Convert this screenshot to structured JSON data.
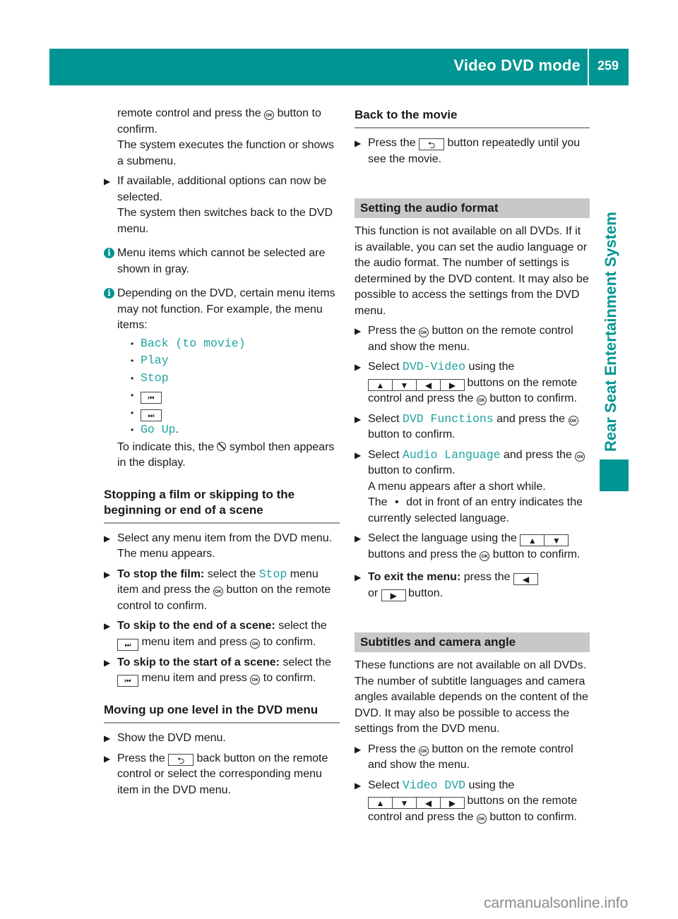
{
  "header": {
    "title": "Video DVD mode",
    "page_number": "259",
    "side_tab": "Rear Seat Entertainment System",
    "accent_color": "#009593"
  },
  "left": {
    "intro_cont_1": "remote control and press the",
    "intro_cont_2": "button to confirm.",
    "intro_cont_3": "The system executes the function or shows a submenu.",
    "step_available": "If available, additional options can now be selected.",
    "step_available_result": "The system then switches back to the DVD menu.",
    "info_gray": "Menu items which cannot be selected are shown in gray.",
    "info_depending": "Depending on the DVD, certain menu items may not function. For example, the menu items:",
    "menu_items": [
      "Back (to movie)",
      "Play",
      "Stop",
      "Go Up"
    ],
    "prev_key": "⏮",
    "next_key": "⏭",
    "go_up_suffix": ".",
    "indicate_1": "To indicate this, the",
    "indicate_2": "symbol then appears in the display.",
    "section_stop": {
      "heading": "Stopping a film or skipping to the beginning or end of a scene",
      "step1": "Select any menu item from the DVD menu.",
      "step1_result": "The menu appears.",
      "step2_bold": "To stop the film:",
      "step2_a": "select the",
      "step2_code": "Stop",
      "step2_b": "menu item and press the",
      "step2_c": "button on the remote control to confirm.",
      "step3_bold": "To skip to the end of a scene:",
      "step3_a": "select the",
      "step3_b": "menu item and press",
      "step3_c": "to confirm.",
      "step4_bold": "To skip to the start of a scene:",
      "step4_a": "select the",
      "step4_b": "menu item and press",
      "step4_c": "to confirm."
    },
    "section_up": {
      "heading": "Moving up one level in the DVD menu",
      "step1": "Show the DVD menu.",
      "step2_a": "Press the",
      "step2_b": "back button on the remote control or select the corresponding menu item in the DVD menu."
    }
  },
  "right": {
    "section_back": {
      "heading": "Back to the movie",
      "step1_a": "Press the",
      "step1_b": "button repeatedly until you see the movie."
    },
    "section_audio": {
      "heading": "Setting the audio format",
      "intro": "This function is not available on all DVDs. If it is available, you can set the audio language or the audio format. The number of settings is determined by the DVD content. It may also be possible to access the settings from the DVD menu.",
      "step1_a": "Press the",
      "step1_b": "button on the remote control and show the menu.",
      "step2_a": "Select",
      "step2_code": "DVD-Video",
      "step2_b": "using the",
      "step2_c": "buttons on the remote control and press the",
      "step2_d": "button to confirm.",
      "step3_a": "Select",
      "step3_code": "DVD Functions",
      "step3_b": "and press the",
      "step3_c": "button to confirm.",
      "step4_a": "Select",
      "step4_code": "Audio Language",
      "step4_b": "and press the",
      "step4_c": "button to confirm.",
      "step4_r1": "A menu appears after a short while.",
      "step4_r2a": "The",
      "step4_r2b": "dot in front of an entry indicates the currently selected language.",
      "step5_a": "Select the language using the",
      "step5_b": "buttons and press the",
      "step5_c": "button to confirm.",
      "step6_bold": "To exit the menu:",
      "step6_a": "press the",
      "step6_b": "or",
      "step6_c": "button."
    },
    "section_subtitles": {
      "heading": "Subtitles and camera angle",
      "intro": "These functions are not available on all DVDs. The number of subtitle languages and camera angles available depends on the content of the DVD. It may also be possible to access the settings from the DVD menu.",
      "step1_a": "Press the",
      "step1_b": "button on the remote control and show the menu.",
      "step2_a": "Select",
      "step2_code": "Video DVD",
      "step2_b": "using the",
      "step2_c": "buttons on the remote control and press the",
      "step2_d": "button to confirm."
    }
  },
  "glyphs": {
    "ok": "OK",
    "back": "⮌",
    "up": "▲",
    "down": "▼",
    "left": "◀",
    "right": "▶",
    "arrow": "▶",
    "bullet": "•",
    "info": "i"
  },
  "watermark": "carmanualsonline.info"
}
